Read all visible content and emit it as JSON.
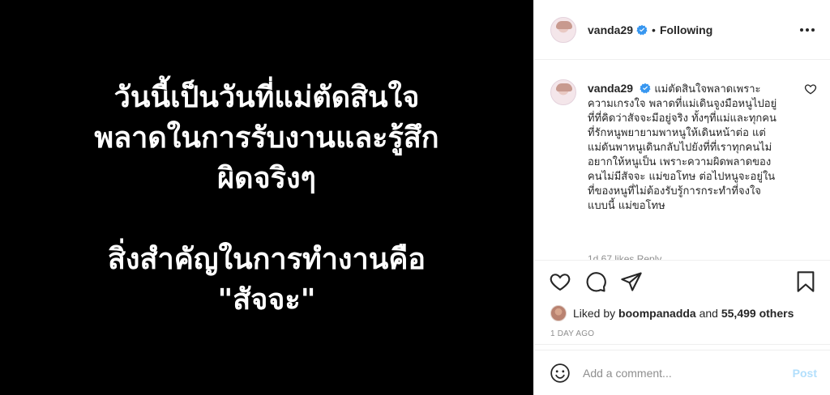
{
  "media": {
    "lines_block1": [
      "วันนี้เป็นวันที่แม่ตัดสินใจ",
      "พลาดในการรับงานและรู้สึก",
      "ผิดจริงๆ"
    ],
    "lines_block2": [
      "สิ่งสำคัญในการทำงานคือ",
      "\"สัจจะ\""
    ]
  },
  "header": {
    "username": "vanda29",
    "separator": "•",
    "follow_status": "Following",
    "verified_icon": "verified-badge-icon",
    "more_icon": "more-options-icon"
  },
  "caption": {
    "username": "vanda29",
    "text": "แม่ตัดสินใจพลาดเพราะความเกรงใจ พลาดที่แม่เดินจูงมือหนูไปอยู่ที่ที่คิดว่าสัจจะมีอยู่จริง ทั้งๆที่แม่และทุกคนที่รักหนูพยายามพาหนูให้เดินหน้าต่อ แต่แม่ดันพาหนูเดินกลับไปยังที่ที่เราทุกคนไม่อยากให้หนูเป็น เพราะความผิดพลาดของคนไม่มีสัจจะ แม่ขอโทษ ต่อไปหนูจะอยู่ในที่ของหนูที่ไม่ต้องรับรู้การกระทำที่จงใจแบบนี้ แม่ขอโทษ",
    "meta_cut": "1d  67 likes  Reply"
  },
  "actions": {
    "like_icon": "heart-icon",
    "comment_icon": "comment-icon",
    "share_icon": "share-icon",
    "save_icon": "bookmark-icon"
  },
  "likes": {
    "prefix": "Liked by",
    "user": "boompanadda",
    "conjunction": "and",
    "count": "55,499 others"
  },
  "timestamp": "1 DAY AGO",
  "comment_box": {
    "placeholder": "Add a comment...",
    "post_label": "Post",
    "emoji_icon": "emoji-icon"
  },
  "colors": {
    "verified_blue": "#3897f0",
    "post_disabled": "#b2dffc",
    "muted": "#8e8e8e"
  }
}
